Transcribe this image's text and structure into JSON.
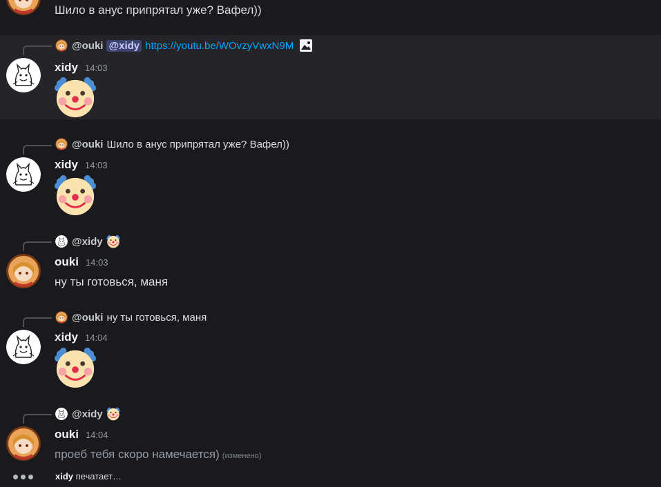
{
  "top_message": {
    "text": "Шило в анус припрятал уже? Вафел))"
  },
  "messages": [
    {
      "reply": {
        "author": "@ouki",
        "mention": "@xidy",
        "link": "https://youtu.be/WOvzyVwxN9M"
      },
      "author": "xidy",
      "time": "14:03",
      "content": "clown-emoji"
    },
    {
      "reply": {
        "author": "@ouki",
        "text": "Шило в анус припрятал уже? Вафел))"
      },
      "author": "xidy",
      "time": "14:03",
      "content": "clown-emoji"
    },
    {
      "reply": {
        "author": "@xidy"
      },
      "author": "ouki",
      "time": "14:03",
      "text": "ну ты готовься, маня"
    },
    {
      "reply": {
        "author": "@ouki",
        "text": "ну ты готовься, маня"
      },
      "author": "xidy",
      "time": "14:04",
      "content": "clown-emoji"
    },
    {
      "reply": {
        "author": "@xidy"
      },
      "author": "ouki",
      "time": "14:04",
      "text": "проеб тебя скоро намечается)",
      "edited": "(изменено)"
    }
  ],
  "typing": {
    "user": "xidy",
    "label": "печатает…"
  },
  "colors": {
    "background": "#1a1a1e",
    "highlight": "#242429",
    "link": "#00a8fc",
    "mention_bg": "#3c4270"
  }
}
